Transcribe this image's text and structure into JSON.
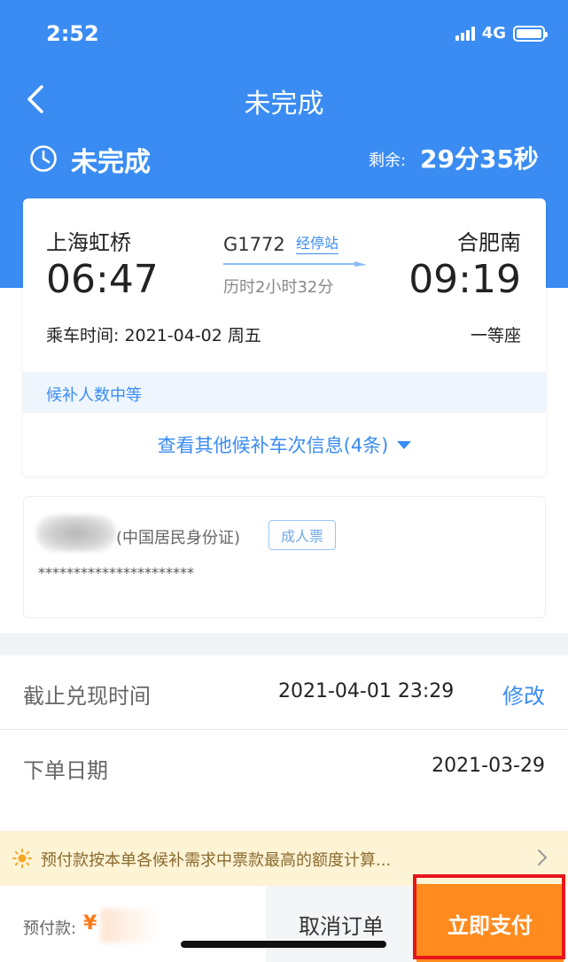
{
  "status_bar": {
    "time": "2:52",
    "network": "4G"
  },
  "nav": {
    "title": "未完成"
  },
  "order_status": {
    "label": "未完成",
    "remain_label": "剩余:",
    "remain_value": "29分35秒"
  },
  "trip": {
    "from_station": "上海虹桥",
    "from_time": "06:47",
    "to_station": "合肥南",
    "to_time": "09:19",
    "train_no": "G1772",
    "stops_link": "经停站",
    "duration": "历时2小时32分",
    "ride_date": "乘车时间: 2021-04-02 周五",
    "seat_type": "一等座",
    "waitlist_level": "候补人数中等",
    "other_trains": "查看其他候补车次信息(4条)"
  },
  "passenger": {
    "id_type": "(中国居民身份证)",
    "ticket_type": "成人票",
    "id_number": "**********************"
  },
  "info": {
    "deadline_label": "截止兑现时间",
    "deadline_value": "2021-04-01 23:29",
    "modify": "修改",
    "order_date_label": "下单日期",
    "order_date_value": "2021-03-29"
  },
  "notice": {
    "text": "预付款按本单各候补需求中票款最高的额度计算..."
  },
  "bottom": {
    "prepay_label": "预付款:",
    "currency": "¥",
    "cancel": "取消订单",
    "pay": "立即支付"
  },
  "colors": {
    "primary_blue": "#3a8cf3",
    "pay_orange": "#ff8b1e",
    "highlight_red": "#e8151b",
    "notice_bg": "#fdf3d5"
  },
  "icons": [
    "back-chevron-icon",
    "clock-icon",
    "bulb-icon",
    "chevron-right-icon",
    "triangle-down-icon",
    "signal-icon",
    "battery-icon"
  ]
}
